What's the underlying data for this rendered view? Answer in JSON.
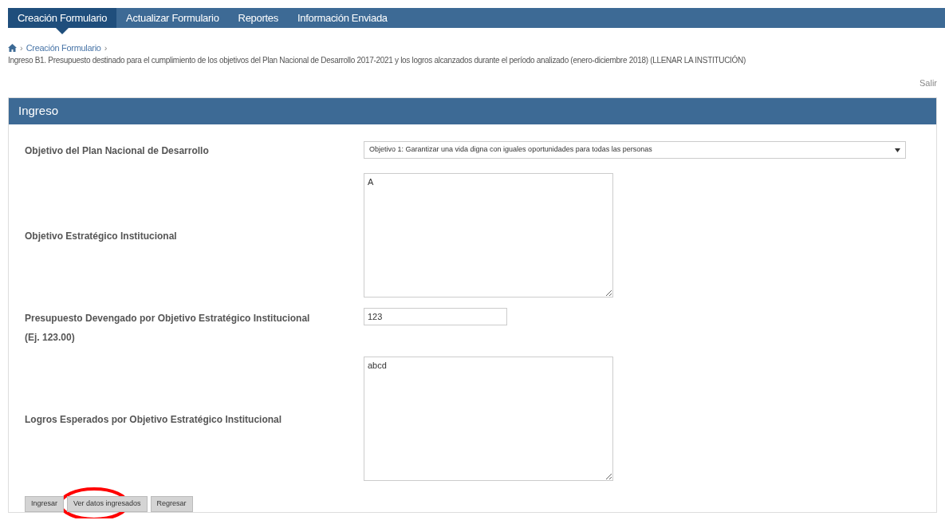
{
  "nav": {
    "tabs": [
      {
        "label": "Creación Formulario",
        "selected": true
      },
      {
        "label": "Actualizar Formulario",
        "selected": false
      },
      {
        "label": "Reportes",
        "selected": false
      },
      {
        "label": "Información Enviada",
        "selected": false
      }
    ]
  },
  "breadcrumb": {
    "items": [
      "Creación Formulario"
    ],
    "separator": "›"
  },
  "page_title": "Ingreso B1. Presupuesto destinado para el cumplimiento de los objetivos del Plan Nacional de Desarrollo 2017-2021 y los logros alcanzados durante el período analizado (enero-diciembre 2018) (LLENAR LA INSTITUCIÓN)",
  "logout_link": "Salir",
  "panel": {
    "title": "Ingreso",
    "fields": [
      {
        "kind": "select",
        "label": "Objetivo del Plan Nacional de Desarrollo",
        "value": "Objetivo 1: Garantizar una vida digna con iguales oportunidades para todas las personas"
      },
      {
        "kind": "textarea",
        "label": "Objetivo Estratégico Institucional",
        "value": "A"
      },
      {
        "kind": "input",
        "label": "Presupuesto Devengado por Objetivo Estratégico Institucional (Ej. 123.00)",
        "value": "123"
      },
      {
        "kind": "textarea",
        "label": "Logros Esperados por Objetivo Estratégico Institucional",
        "value": "abcd"
      }
    ],
    "buttons": [
      "Ingresar",
      "Ver datos ingresados",
      "Regresar"
    ]
  },
  "annotation": {
    "kind": "circle",
    "color": "#ff0000"
  }
}
